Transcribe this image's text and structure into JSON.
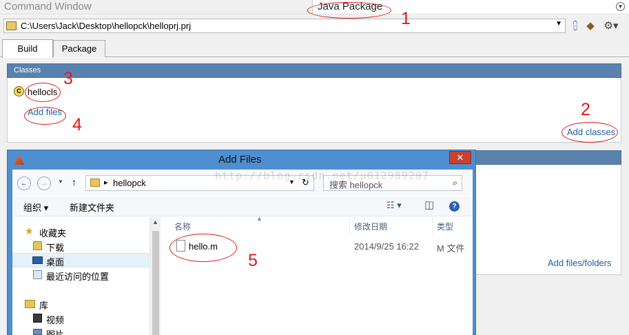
{
  "titlebars": {
    "command_window": "Command Window",
    "java_package": "Java Package"
  },
  "project": {
    "path": "C:\\Users\\Jack\\Desktop\\hellopck\\helloprj.prj"
  },
  "tabs": [
    {
      "label": "Build"
    },
    {
      "label": "Package"
    }
  ],
  "classes": {
    "header": "Classes",
    "class_name": "hellocls",
    "class_icon_letter": "C",
    "add_files": "Add files",
    "add_classes": "Add classes"
  },
  "files": {
    "add_files_folders": "Add files/folders"
  },
  "dialog": {
    "title": "Add Files",
    "close": "✕",
    "address": {
      "folder": "hellopck",
      "search_placeholder": "搜索 hellopck"
    },
    "commands": {
      "organize": "组织 ▾",
      "new_folder": "新建文件夹"
    },
    "nav_pane": [
      {
        "label": "收藏夹",
        "icon": "star-icon"
      },
      {
        "label": "下载",
        "icon": "download-folder-icon"
      },
      {
        "label": "桌面",
        "icon": "desktop-icon"
      },
      {
        "label": "最近访问的位置",
        "icon": "recent-places-icon"
      },
      {
        "label": "库",
        "icon": "library-icon"
      },
      {
        "label": "视频",
        "icon": "video-icon"
      },
      {
        "label": "图片",
        "icon": "pictures-icon"
      }
    ],
    "columns": {
      "name": "名称",
      "date": "修改日期",
      "type": "类型"
    },
    "file": {
      "name": "hello.m",
      "date": "2014/9/25 16:22",
      "type": "M 文件"
    }
  },
  "watermark": "http://blog.csdn.net/u012989207",
  "annotations": [
    "1",
    "2",
    "3",
    "4",
    "5"
  ],
  "colors": {
    "annotation_red": "#e01818",
    "header_blue": "#5a82ae",
    "dialog_frame": "#4d8fd1",
    "link_blue": "#1b5fa5"
  }
}
